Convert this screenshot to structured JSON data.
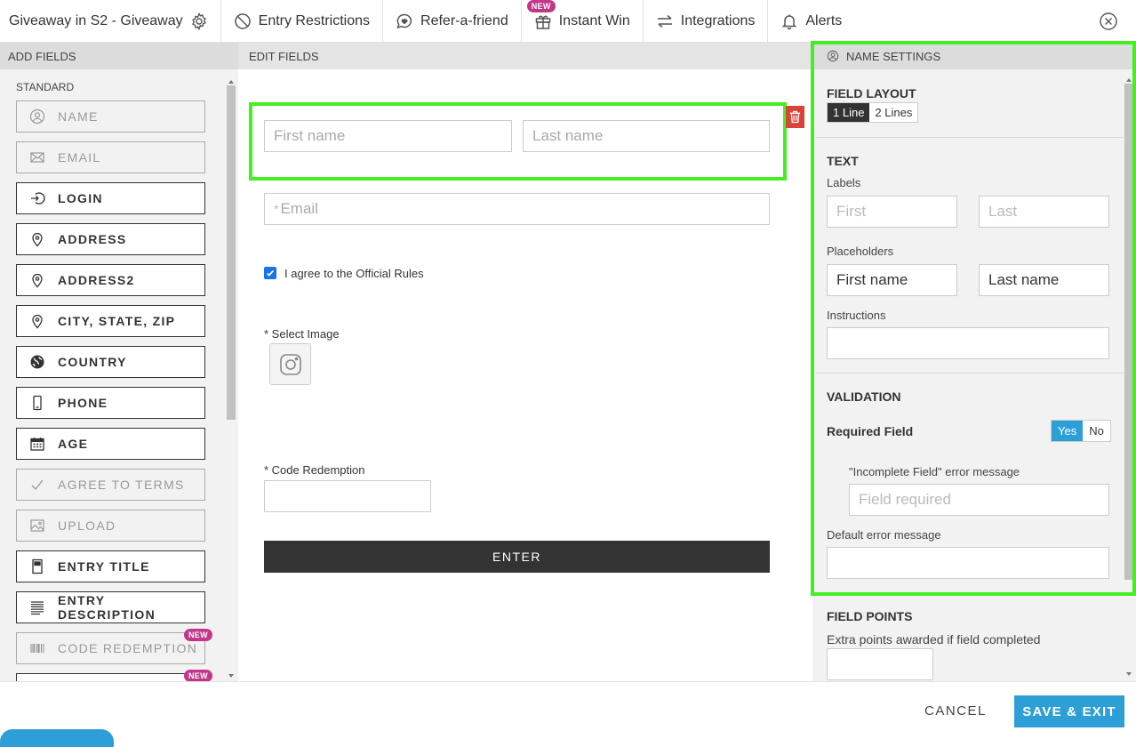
{
  "topnav": {
    "title": "Giveaway in S2 - Giveaway",
    "entry_restrictions": "Entry Restrictions",
    "refer": "Refer-a-friend",
    "new_badge": "NEW",
    "instant_win": "Instant Win",
    "integrations": "Integrations",
    "alerts": "Alerts"
  },
  "left": {
    "header": "ADD FIELDS",
    "section": "STANDARD",
    "new_badge": "NEW",
    "items": [
      {
        "label": "NAME",
        "icon": "user-circle-icon",
        "disabled": true
      },
      {
        "label": "EMAIL",
        "icon": "envelope-icon",
        "disabled": true
      },
      {
        "label": "LOGIN",
        "icon": "login-icon",
        "disabled": false
      },
      {
        "label": "ADDRESS",
        "icon": "map-pin-icon",
        "disabled": false
      },
      {
        "label": "ADDRESS2",
        "icon": "map-pin-icon",
        "disabled": false
      },
      {
        "label": "CITY, STATE, ZIP",
        "icon": "map-pin-icon",
        "disabled": false
      },
      {
        "label": "COUNTRY",
        "icon": "globe-icon",
        "disabled": false
      },
      {
        "label": "PHONE",
        "icon": "phone-icon",
        "disabled": false
      },
      {
        "label": "AGE",
        "icon": "calendar-icon",
        "disabled": false
      },
      {
        "label": "AGREE TO TERMS",
        "icon": "check-icon",
        "disabled": true
      },
      {
        "label": "UPLOAD",
        "icon": "image-icon",
        "disabled": true
      },
      {
        "label": "ENTRY TITLE",
        "icon": "document-icon",
        "disabled": false
      },
      {
        "label": "ENTRY DESCRIPTION",
        "icon": "text-lines-icon",
        "disabled": false
      },
      {
        "label": "CODE REDEMPTION",
        "icon": "barcode-icon",
        "disabled": true
      }
    ]
  },
  "middle": {
    "header": "EDIT FIELDS",
    "first_name_ph": "First name",
    "last_name_ph": "Last name",
    "email_star": "*",
    "email_ph": "Email",
    "agree_label": "I agree to the Official Rules",
    "select_image": "* Select Image",
    "code_redemption": "* Code Redemption",
    "enter_button": "ENTER"
  },
  "right": {
    "header": "NAME SETTINGS",
    "field_layout": "FIELD LAYOUT",
    "layout_opts": [
      "1 Line",
      "2 Lines"
    ],
    "text": "TEXT",
    "labels": "Labels",
    "label_first_ph": "First",
    "label_last_ph": "Last",
    "placeholders": "Placeholders",
    "placeholder_first": "First name",
    "placeholder_last": "Last name",
    "instructions": "Instructions",
    "validation": "VALIDATION",
    "required_field": "Required Field",
    "yes": "Yes",
    "no": "No",
    "incomplete_label": "\"Incomplete Field\" error message",
    "incomplete_ph": "Field required",
    "default_error": "Default error message",
    "field_points": "FIELD POINTS",
    "extra_points": "Extra points awarded if field completed"
  },
  "footer": {
    "cancel": "CANCEL",
    "save": "SAVE & EXIT"
  },
  "colors": {
    "highlight": "#44ee22",
    "accent_blue": "#2e9fd6",
    "badge": "#c2378a",
    "trash_red": "#d9443a"
  }
}
